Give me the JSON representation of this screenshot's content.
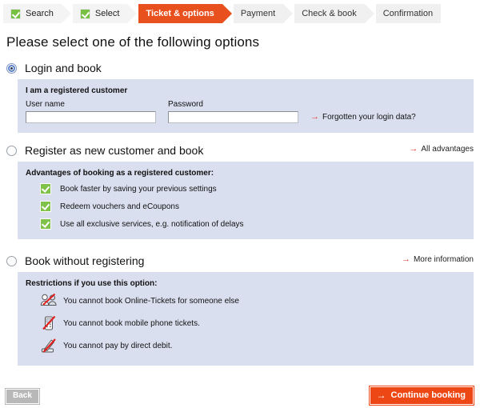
{
  "steps": [
    {
      "label": "Search",
      "state": "done",
      "icon": "check-icon"
    },
    {
      "label": "Select",
      "state": "done",
      "icon": "check-icon"
    },
    {
      "label": "Ticket & options",
      "state": "active",
      "icon": ""
    },
    {
      "label": "Payment",
      "state": "upcoming",
      "icon": ""
    },
    {
      "label": "Check & book",
      "state": "upcoming",
      "icon": ""
    },
    {
      "label": "Confirmation",
      "state": "upcoming",
      "icon": ""
    }
  ],
  "page": {
    "title": "Please select one of the following options"
  },
  "options": [
    {
      "label": "Login and book",
      "selected": true,
      "panel": {
        "title": "I am a registered customer",
        "username_label": "User name",
        "username_value": "",
        "username_placeholder": "",
        "password_label": "Password",
        "password_value": "",
        "password_placeholder": "",
        "forgot_link": "Forgotten your login data?"
      }
    },
    {
      "label": "Register as new customer and book",
      "selected": false,
      "side_link": "All advantages",
      "panel": {
        "title": "Advantages of booking as a registered customer:",
        "items": [
          {
            "icon": "green-check-icon",
            "text": "Book faster by saving your previous settings"
          },
          {
            "icon": "green-check-icon",
            "text": "Redeem vouchers and eCoupons"
          },
          {
            "icon": "green-check-icon",
            "text": "Use all exclusive services, e.g. notification of delays"
          }
        ]
      }
    },
    {
      "label": "Book without registering",
      "selected": false,
      "side_link": "More information",
      "panel": {
        "title": "Restrictions if you use this option:",
        "items": [
          {
            "icon": "no-two-people-icon",
            "text": "You cannot book Online-Tickets for someone else"
          },
          {
            "icon": "no-mobile-phone-icon",
            "text": "You cannot book mobile phone tickets."
          },
          {
            "icon": "no-direct-debit-icon",
            "text": "You cannot pay by direct debit."
          }
        ]
      }
    }
  ],
  "footer": {
    "back_label": "Back",
    "continue_label": "Continue booking",
    "continue_arrow": "→"
  },
  "colors": {
    "active_step": "#e8501e",
    "panel_bg": "#d9dfee",
    "accent_red": "#e4392f",
    "continue_button": "#ec4715",
    "check_green": "#7fc24a"
  }
}
